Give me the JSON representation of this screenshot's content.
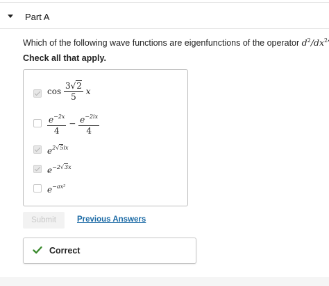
{
  "part": {
    "title": "Part A"
  },
  "question": {
    "prefix": "Which of the following wave functions are eigenfunctions of the operator ",
    "operator_d1": "d",
    "operator_exp1": "2",
    "operator_sep": "/",
    "operator_d2": "dx",
    "operator_exp2": "2",
    "suffix": "?"
  },
  "instruction": "Check all that apply.",
  "options": [
    {
      "checked": true,
      "func": "cos",
      "num_coef": "3",
      "num_root": "2",
      "den": "5",
      "var": "x"
    },
    {
      "checked": false,
      "e1": "e",
      "e1_sup": "−2x",
      "den1": "4",
      "op": "−",
      "e2": "e",
      "e2_sup": "−2ix",
      "den2": "4"
    },
    {
      "checked": true,
      "base": "e",
      "sup_pre": "2",
      "sup_root": "5",
      "sup_post": "ix"
    },
    {
      "checked": true,
      "base": "e",
      "sup_pre": "−2",
      "sup_root": "3",
      "sup_post": "x"
    },
    {
      "checked": false,
      "base": "e",
      "sup": "−ax²"
    }
  ],
  "buttons": {
    "submit": "Submit",
    "previous_answers": "Previous Answers"
  },
  "feedback": {
    "text": "Correct",
    "color": "#3a8a2d"
  },
  "colors": {
    "link": "#1b6aa5",
    "accent_check": "#3a8a2d"
  }
}
